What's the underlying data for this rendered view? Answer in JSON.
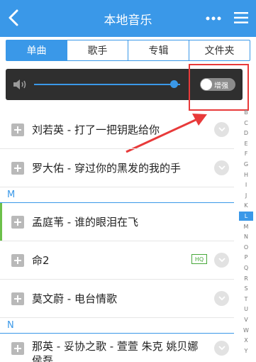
{
  "header": {
    "title": "本地音乐",
    "background_color": "#3a98e8",
    "back_icon": "chevron-left-icon",
    "more_icon": "more-dots-icon",
    "menu_icon": "menu-lines-icon"
  },
  "tabs": [
    {
      "label": "单曲",
      "active": true
    },
    {
      "label": "歌手",
      "active": false
    },
    {
      "label": "专辑",
      "active": false
    },
    {
      "label": "文件夹",
      "active": false
    }
  ],
  "volume": {
    "icon": "speaker-icon",
    "level": 0.96,
    "toggle_label": "增强",
    "toggle_on": false
  },
  "annotation": {
    "color": "#e83a3a"
  },
  "list": {
    "rows": [
      {
        "text": "刘若英 - 打了一把钥匙给你"
      },
      {
        "text": "罗大佑 - 穿过你的黑发的我的手"
      },
      {
        "section": "M"
      },
      {
        "text": "孟庭苇 - 谁的眼泪在飞",
        "active": true
      },
      {
        "text": "命2",
        "badge": "HQ"
      },
      {
        "text": "莫文蔚 - 电台情歌"
      },
      {
        "section": "N"
      },
      {
        "text": "那英 - 妥协之歌 - 萱萱 朱克 姚贝娜 侯磊"
      }
    ]
  },
  "alphabet": {
    "letters": [
      "B",
      "C",
      "D",
      "E",
      "F",
      "G",
      "H",
      "I",
      "J",
      "K",
      "L",
      "M",
      "N",
      "O",
      "P",
      "Q",
      "R",
      "S",
      "T",
      "U",
      "V",
      "W",
      "X",
      "Y"
    ],
    "selected": "L"
  }
}
